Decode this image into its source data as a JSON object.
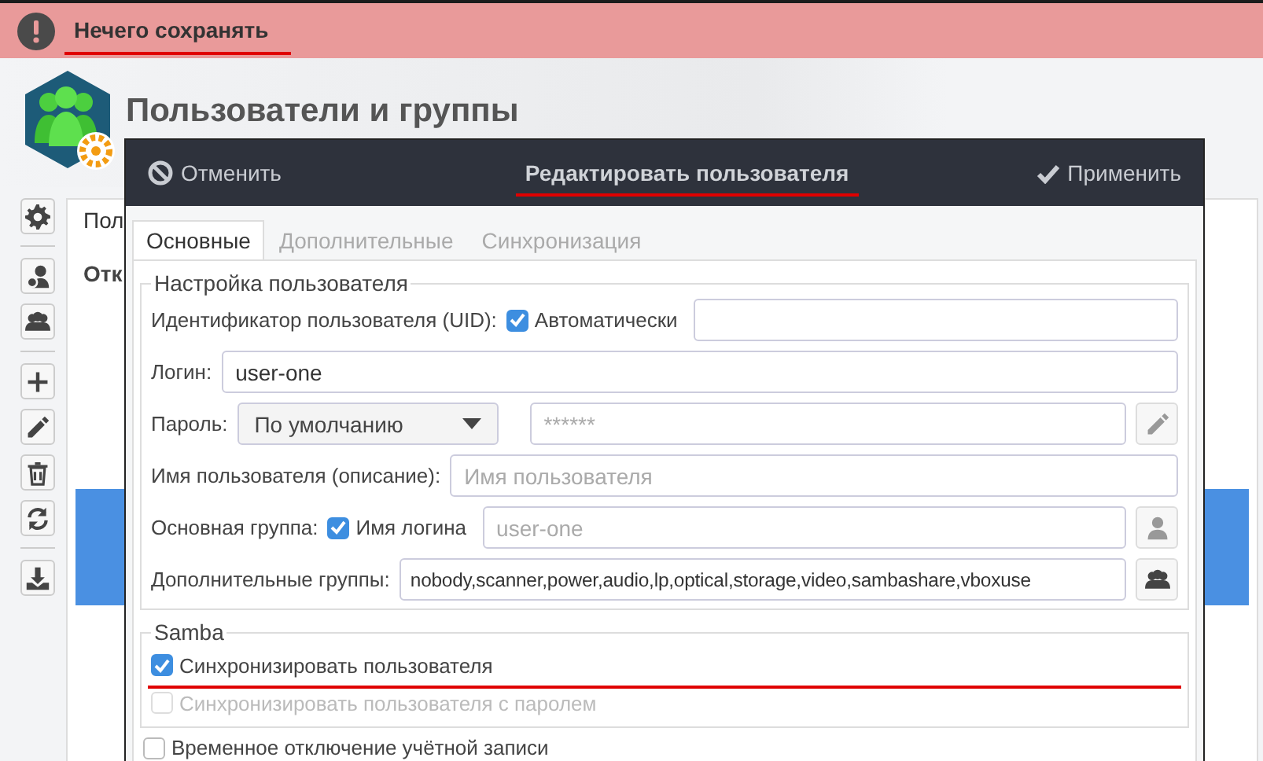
{
  "notification": {
    "text": "Нечего сохранять",
    "underlined": true
  },
  "app": {
    "title": "Пользователи и группы",
    "tab": "Пол",
    "column_1": "Отк"
  },
  "dialog": {
    "cancel": "Отменить",
    "title": "Редактировать пользователя",
    "title_underlined": true,
    "apply": "Применить",
    "tabs": [
      {
        "label": "Основные",
        "selected": true
      },
      {
        "label": "Дополнительные",
        "selected": false
      },
      {
        "label": "Синхронизация",
        "selected": false
      }
    ],
    "user_group": {
      "title": "Настройка пользователя",
      "rows": [
        {
          "kind": "auto_field",
          "label": "Идентификатор пользователя (UID):",
          "checkbox": {
            "label": "Автоматически",
            "checked": true
          }
        },
        {
          "kind": "field",
          "label": "Логин:",
          "value": "user-one"
        },
        {
          "kind": "password",
          "label": "Пароль:",
          "select": "По умолчанию",
          "placeholder": "******"
        },
        {
          "kind": "field",
          "label": "Имя пользователя (описание):",
          "placeholder": "Имя пользователя"
        },
        {
          "kind": "group_field",
          "label": "Основная группа:",
          "checkbox": {
            "label": "Имя логина",
            "checked": true
          },
          "placeholder": "user-one"
        },
        {
          "kind": "list_field",
          "label": "Дополнительные группы:",
          "value": "nobody,scanner,power,audio,lp,optical,storage,video,sambashare,vboxuse"
        }
      ]
    },
    "samba": {
      "title": "Samba",
      "options": [
        {
          "label": "Синхронизировать пользователя",
          "checked": true,
          "disabled": false,
          "underlined": true
        },
        {
          "label": "Синхронизировать пользователя с паролем",
          "checked": false,
          "disabled": true,
          "underlined": false
        }
      ]
    },
    "disable_account": {
      "label": "Временное отключение учётной записи",
      "checked": false
    }
  }
}
